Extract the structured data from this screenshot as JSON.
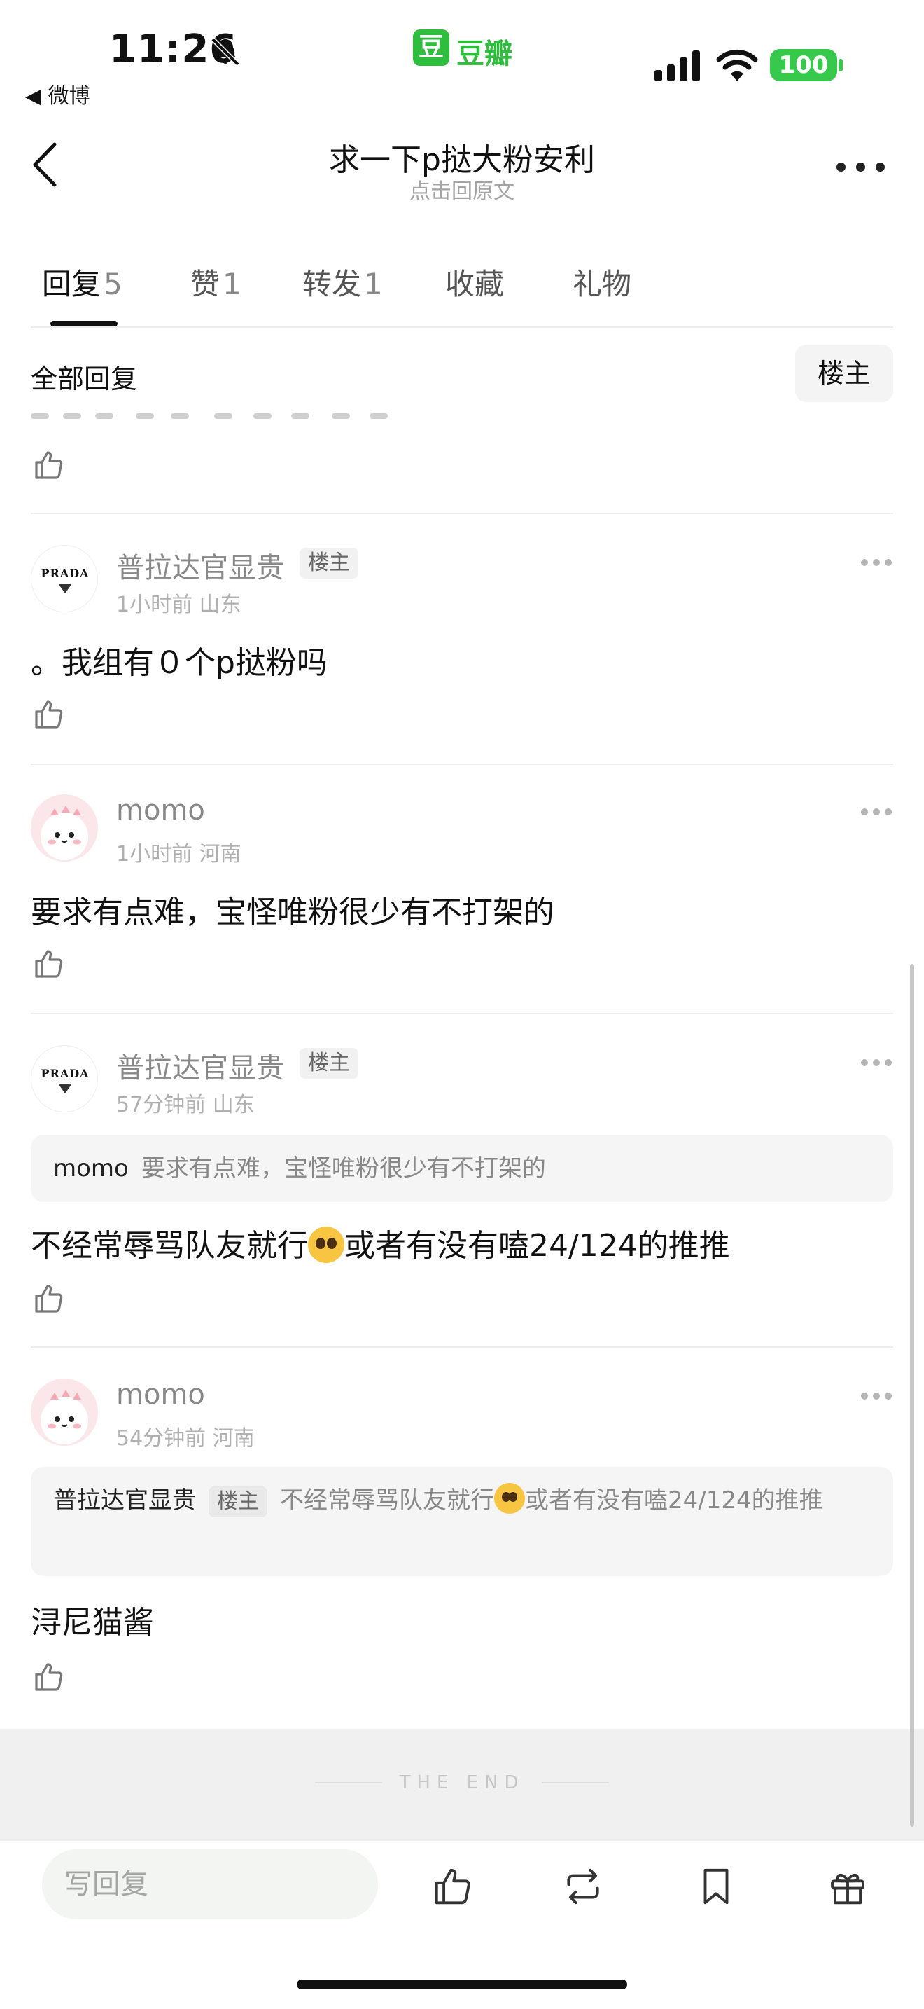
{
  "status_bar": {
    "time": "11:26",
    "back_app": "◀ 微博",
    "app_badge": "豆",
    "app_name": "豆瓣",
    "battery": "100"
  },
  "header": {
    "title": "求一下p挞大粉安利",
    "subtitle": "点击回原文"
  },
  "tabs": [
    {
      "label": "回复",
      "count": "5"
    },
    {
      "label": "赞",
      "count": "1"
    },
    {
      "label": "转发",
      "count": "1"
    },
    {
      "label": "收藏",
      "count": ""
    },
    {
      "label": "礼物",
      "count": ""
    }
  ],
  "filter": {
    "all_label": "全部回复",
    "owner_label": "楼主"
  },
  "comments": [
    {
      "user": "普拉达官显贵",
      "tag": "楼主",
      "meta": "1小时前 山东",
      "content": "。我组有０个p挞粉吗"
    },
    {
      "user": "momo",
      "tag": "",
      "meta": "1小时前 河南",
      "content": "要求有点难，宝怪唯粉很少有不打架的"
    },
    {
      "user": "普拉达官显贵",
      "tag": "楼主",
      "meta": "57分钟前 山东",
      "quote_user": "momo",
      "quote_text": "要求有点难，宝怪唯粉很少有不打架的",
      "content_a": "不经常辱骂队友就行",
      "content_b": "或者有没有嗑24/124的推推"
    },
    {
      "user": "momo",
      "tag": "",
      "meta": "54分钟前 河南",
      "quote_user": "普拉达官显贵",
      "quote_tag": "楼主",
      "quote_text_a": "不经常辱骂队友就行",
      "quote_text_b": "或者有没有嗑24/124的推推",
      "content": "浔尼猫酱"
    }
  ],
  "avatar_logo": "PRADA",
  "end_text": "THE END",
  "bottom": {
    "reply_placeholder": "写回复"
  },
  "colors": {
    "accent": "#2fbd3e",
    "battery": "#37c94b"
  }
}
